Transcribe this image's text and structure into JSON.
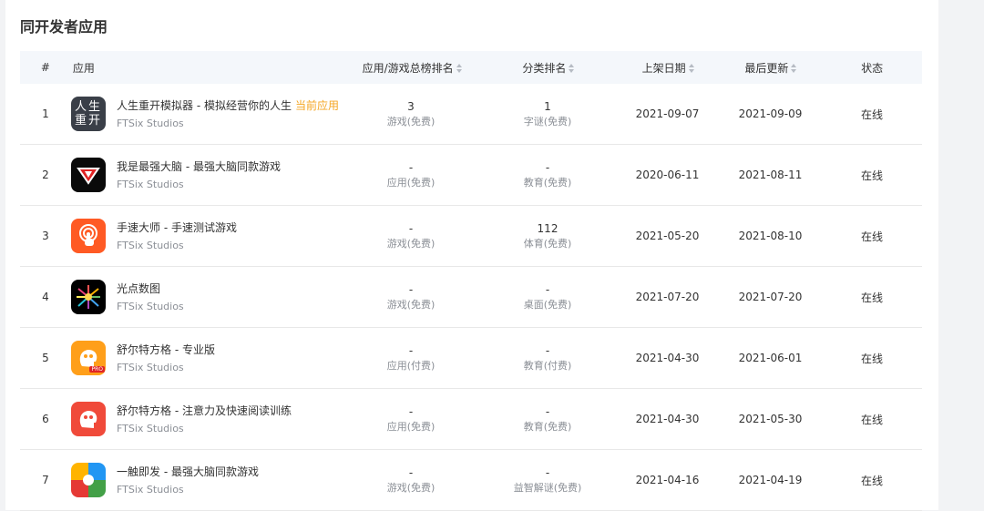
{
  "section": {
    "title": "同开发者应用"
  },
  "table": {
    "headers": {
      "num": "#",
      "app": "应用",
      "rank": "应用/游戏总榜排名",
      "cat": "分类排名",
      "date": "上架日期",
      "updated": "最后更新",
      "status": "状态"
    },
    "rows": [
      {
        "num": "1",
        "name": "人生重开模拟器 - 模拟经营你的人生",
        "tag": "当前应用",
        "developer": "FTSix Studios",
        "rank": "3",
        "rank_cat": "游戏(免费)",
        "cat_rank": "1",
        "cat_name": "字谜(免费)",
        "date": "2021-09-07",
        "updated": "2021-09-09",
        "status": "在线",
        "icon": "life-restart-icon",
        "icon_text": "人生重开"
      },
      {
        "num": "2",
        "name": "我是最强大脑 - 最强大脑同款游戏",
        "tag": "",
        "developer": "FTSix Studios",
        "rank": "-",
        "rank_cat": "应用(免费)",
        "cat_rank": "-",
        "cat_name": "教育(免费)",
        "date": "2020-06-11",
        "updated": "2021-08-11",
        "status": "在线",
        "icon": "super-brain-icon"
      },
      {
        "num": "3",
        "name": "手速大师 - 手速测试游戏",
        "tag": "",
        "developer": "FTSix Studios",
        "rank": "-",
        "rank_cat": "游戏(免费)",
        "cat_rank": "112",
        "cat_name": "体育(免费)",
        "date": "2021-05-20",
        "updated": "2021-08-10",
        "status": "在线",
        "icon": "tap-hand-icon"
      },
      {
        "num": "4",
        "name": "光点数图",
        "tag": "",
        "developer": "FTSix Studios",
        "rank": "-",
        "rank_cat": "游戏(免费)",
        "cat_rank": "-",
        "cat_name": "桌面(免费)",
        "date": "2021-07-20",
        "updated": "2021-07-20",
        "status": "在线",
        "icon": "light-dots-icon"
      },
      {
        "num": "5",
        "name": "舒尔特方格 - 专业版",
        "tag": "",
        "developer": "FTSix Studios",
        "rank": "-",
        "rank_cat": "应用(付费)",
        "cat_rank": "-",
        "cat_name": "教育(付费)",
        "date": "2021-04-30",
        "updated": "2021-06-01",
        "status": "在线",
        "icon": "schulte-pro-icon"
      },
      {
        "num": "6",
        "name": "舒尔特方格 - 注意力及快速阅读训练",
        "tag": "",
        "developer": "FTSix Studios",
        "rank": "-",
        "rank_cat": "应用(免费)",
        "cat_rank": "-",
        "cat_name": "教育(免费)",
        "date": "2021-04-30",
        "updated": "2021-05-30",
        "status": "在线",
        "icon": "schulte-icon"
      },
      {
        "num": "7",
        "name": "一触即发 - 最强大脑同款游戏",
        "tag": "",
        "developer": "FTSix Studios",
        "rank": "-",
        "rank_cat": "游戏(免费)",
        "cat_rank": "-",
        "cat_name": "益智解谜(免费)",
        "date": "2021-04-16",
        "updated": "2021-04-19",
        "status": "在线",
        "icon": "quad-color-icon"
      }
    ]
  }
}
